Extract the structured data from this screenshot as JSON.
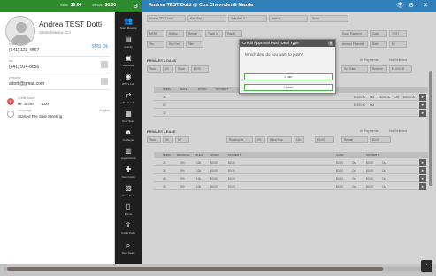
{
  "topbar": {
    "sales_label": "Sales",
    "sales_value": "$0.00",
    "service_label": "Service",
    "service_value": "$0.00",
    "gear_icon": "gear-icon"
  },
  "deal_header": {
    "title": "Andrea TEST Dotti @ Cox Chevrolet & Mazda",
    "icons": [
      "eye-icon",
      "gear-icon",
      "close-icon"
    ]
  },
  "contact": {
    "name": "Andrea TEST Dotti",
    "location": "Santa Monica, CA",
    "fields": [
      {
        "label": "home",
        "value": "(941) 123-4567",
        "icon": "phone-icon",
        "extra": "SMS Ok"
      },
      {
        "label": "fax",
        "value": "(941) 914-8656",
        "icon": "fax-icon",
        "extra": ""
      },
      {
        "label": "personal",
        "value": "adotti@gmail.com",
        "icon": "mail-icon",
        "extra": ""
      }
    ],
    "credit": {
      "label": "Credit Score",
      "score_label": "HF Score",
      "score_value": "-100"
    },
    "language": {
      "label": "Language",
      "value": "Started Pre Sale Meeting",
      "right": "English"
    }
  },
  "sidebar": {
    "items": [
      {
        "label": "Team Meeting",
        "icon": "team-icon"
      },
      {
        "label": "Activity",
        "icon": "activity-icon"
      },
      {
        "label": "Websites",
        "icon": "websites-icon"
      },
      {
        "label": "Who's Left",
        "icon": "eye-icon"
      },
      {
        "label": "Trade Ins",
        "icon": "trade-icon"
      },
      {
        "label": "Deal Scan",
        "icon": "scan-icon"
      },
      {
        "label": "Co-Buyer",
        "icon": "cobuyer-icon"
      },
      {
        "label": "Appointment",
        "icon": "calendar-icon"
      },
      {
        "label": "New Credit",
        "icon": "credit-icon"
      },
      {
        "label": "Save Deal",
        "icon": "save-icon"
      },
      {
        "label": "Forms",
        "icon": "forms-icon"
      },
      {
        "label": "Credit Push",
        "icon": "upload-icon"
      },
      {
        "label": "Stop Deals",
        "icon": "search-icon"
      }
    ]
  },
  "main": {
    "header_cells": [
      "Andrea TEST Dotti",
      "Sale Rep 1",
      "Sale Rep 2",
      "Vehicle",
      "Stock",
      "MSRP",
      "Selling",
      "Rebate",
      "Trade In",
      "Payoff",
      "Down Payment",
      "Cash",
      "TEST",
      "Tax",
      "Doc Fee",
      "Title",
      "",
      "",
      "Amount Financed",
      "Rate",
      "$0"
    ],
    "primary_loans": {
      "label": "PRIMARY LOANS",
      "right": "Not Selected",
      "right_label": "All Payments"
    },
    "loan_tabs": [
      "Term",
      "60",
      "Down",
      "$0.00",
      "Buy Rate",
      "",
      "Sell Rate",
      "",
      "Reserve",
      "$1,000.00"
    ],
    "loan_headers": [
      "TERM",
      "RATE",
      "DOWN",
      "PAYMENT",
      "",
      "",
      "",
      "",
      "",
      "",
      "",
      ""
    ],
    "loan_rows": [
      {
        "term": "36",
        "rate": "",
        "right": [
          "$1000.00",
          "Out",
          "$1000.00",
          "Out",
          "$4000.00"
        ]
      },
      {
        "term": "60",
        "rate": "",
        "right": [
          "$1000.00",
          "Out",
          "",
          "",
          ""
        ]
      },
      {
        "term": "72",
        "rate": "",
        "right": [
          "",
          "",
          "",
          "",
          ""
        ]
      }
    ],
    "primary_lease": {
      "label": "PRIMARY LEASE",
      "right": "Not Selected",
      "right_label": "All Payments"
    },
    "lease_tabs": [
      "Term",
      "36",
      "MF",
      "",
      "Residual %",
      "0%",
      "Miles/Year",
      "12k",
      "$0.00",
      "Rebate",
      "$0.00"
    ],
    "lease_headers": [
      "TERM",
      "RESIDUAL",
      "MILES",
      "DOWN",
      "PAYMENT",
      "",
      "",
      "CASH",
      "PAYMENT"
    ],
    "lease_rows": [
      {
        "term": "24",
        "residual": "0%",
        "miles": "12k",
        "down": "$0.00",
        "pay": "$0.00",
        "cash": "$0.00",
        "cash_tag": "Out",
        "pay2": "$0.00",
        "pay2_tag": "Out"
      },
      {
        "term": "36",
        "residual": "0%",
        "miles": "12k",
        "down": "$0.00",
        "pay": "$0.00",
        "cash": "$0.00",
        "cash_tag": "Out",
        "pay2": "$0.00",
        "pay2_tag": "Out"
      },
      {
        "term": "48",
        "residual": "0%",
        "miles": "12k",
        "down": "$0.00",
        "pay": "$0.00",
        "cash": "$0.00",
        "cash_tag": "Out",
        "pay2": "$0.00",
        "pay2_tag": "Out"
      },
      {
        "term": "39",
        "residual": "0%",
        "miles": "12k",
        "down": "$0.00",
        "pay": "$0.00",
        "cash": "$0.00",
        "cash_tag": "Out",
        "pay2": "$0.00",
        "pay2_tag": "Out"
      }
    ]
  },
  "modal": {
    "title": "Credit Approval Push Deal Type",
    "question": "Which deal do you want to push?",
    "buttons": [
      "Loan",
      "Lease"
    ],
    "close_icon": "close-icon"
  },
  "chat_icon": "chat-icon"
}
